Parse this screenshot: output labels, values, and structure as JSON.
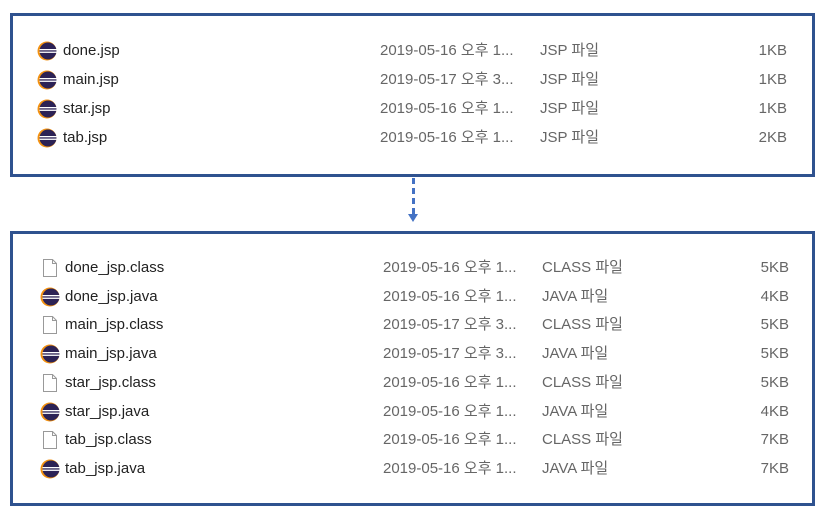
{
  "colors": {
    "border": "#2f528f",
    "arrow": "#4472c4"
  },
  "before": [
    {
      "name": "done.jsp",
      "date": "2019-05-16 오후 1...",
      "type": "JSP 파일",
      "size": "1KB",
      "icon": "eclipse-icon"
    },
    {
      "name": "main.jsp",
      "date": "2019-05-17 오후 3...",
      "type": "JSP 파일",
      "size": "1KB",
      "icon": "eclipse-icon"
    },
    {
      "name": "star.jsp",
      "date": "2019-05-16 오후 1...",
      "type": "JSP 파일",
      "size": "1KB",
      "icon": "eclipse-icon"
    },
    {
      "name": "tab.jsp",
      "date": "2019-05-16 오후 1...",
      "type": "JSP 파일",
      "size": "2KB",
      "icon": "eclipse-icon"
    }
  ],
  "after": [
    {
      "name": "done_jsp.class",
      "date": "2019-05-16 오후 1...",
      "type": "CLASS 파일",
      "size": "5KB",
      "icon": "file-icon"
    },
    {
      "name": "done_jsp.java",
      "date": "2019-05-16 오후 1...",
      "type": "JAVA 파일",
      "size": "4KB",
      "icon": "eclipse-icon"
    },
    {
      "name": "main_jsp.class",
      "date": "2019-05-17 오후 3...",
      "type": "CLASS 파일",
      "size": "5KB",
      "icon": "file-icon"
    },
    {
      "name": "main_jsp.java",
      "date": "2019-05-17 오후 3...",
      "type": "JAVA 파일",
      "size": "5KB",
      "icon": "eclipse-icon"
    },
    {
      "name": "star_jsp.class",
      "date": "2019-05-16 오후 1...",
      "type": "CLASS 파일",
      "size": "5KB",
      "icon": "file-icon"
    },
    {
      "name": "star_jsp.java",
      "date": "2019-05-16 오후 1...",
      "type": "JAVA 파일",
      "size": "4KB",
      "icon": "eclipse-icon"
    },
    {
      "name": "tab_jsp.class",
      "date": "2019-05-16 오후 1...",
      "type": "CLASS 파일",
      "size": "7KB",
      "icon": "file-icon"
    },
    {
      "name": "tab_jsp.java",
      "date": "2019-05-16 오후 1...",
      "type": "JAVA 파일",
      "size": "7KB",
      "icon": "eclipse-icon"
    }
  ]
}
